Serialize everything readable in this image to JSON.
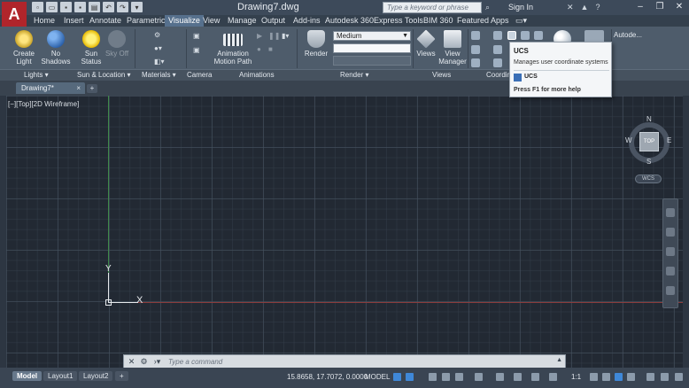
{
  "window": {
    "title": "Drawing7.dwg",
    "logo": "A",
    "search_placeholder": "Type a keyword or phrase",
    "sign_in": "Sign In",
    "minimize": "–",
    "restore": "❐",
    "close": "✕"
  },
  "ribbon_tabs": [
    "Home",
    "Insert",
    "Annotate",
    "Parametric",
    "Visualize",
    "View",
    "Manage",
    "Output",
    "Add-ins",
    "Autodesk 360",
    "Express Tools",
    "BIM 360",
    "Featured Apps"
  ],
  "active_tab": "Visualize",
  "ribbon": {
    "create_light": "Create Light",
    "no_shadows": "No Shadows",
    "sun_status": "Sun Status",
    "sky_off": "Sky Off",
    "animation_motion_path": "Animation Motion Path",
    "render": "Render",
    "render_preset": "Medium",
    "views": "Views",
    "view_manager": "View Manager",
    "autodesk_panel": "Autode...",
    "panels": {
      "lights": "Lights",
      "sun_location": "Sun & Location",
      "materials": "Materials",
      "camera": "Camera",
      "animations": "Animations",
      "render": "Render",
      "views": "Views",
      "coordinates": "Coordin"
    }
  },
  "tooltip": {
    "title": "UCS",
    "description": "Manages user coordinate systems",
    "command": "UCS",
    "help": "Press F1 for more help"
  },
  "file_tab": {
    "name": "Drawing7*",
    "close": "×",
    "add": "+"
  },
  "viewport": {
    "label": "[−][Top][2D Wireframe]",
    "ucs_x": "X",
    "ucs_y": "Y"
  },
  "viewcube": {
    "top": "TOP",
    "n": "N",
    "s": "S",
    "e": "E",
    "w": "W",
    "wcs": "WCS"
  },
  "command_line": {
    "placeholder": "Type a command"
  },
  "status": {
    "layout_tabs": [
      "Model",
      "Layout1",
      "Layout2"
    ],
    "active_layout": "Model",
    "add_layout": "+",
    "coordinates": "15.8658, 17.7072, 0.0000",
    "space": "MODEL",
    "scale": "1:1"
  },
  "colors": {
    "accent": "#56708d",
    "canvas": "#222933",
    "logo": "#b0252b",
    "y_axis": "#3f8a4a",
    "x_axis": "#8a3c3c"
  }
}
